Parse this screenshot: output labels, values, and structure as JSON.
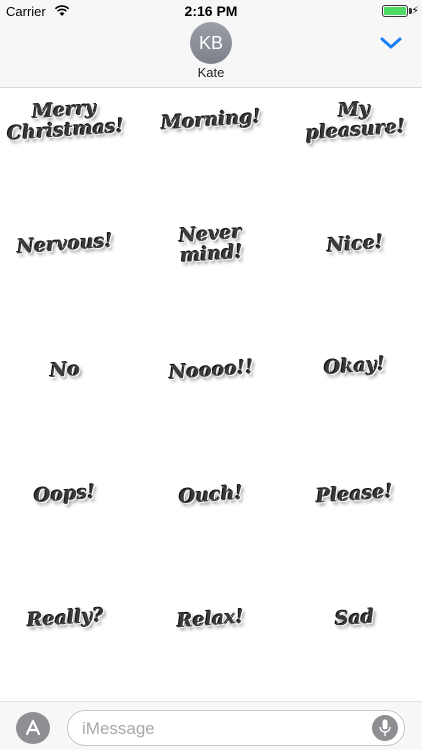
{
  "status_bar": {
    "carrier": "Carrier",
    "time": "2:16 PM",
    "battery_level": 1.0
  },
  "header": {
    "avatar_initials": "KB",
    "contact_name": "Kate"
  },
  "stickers": [
    "Merry Christmas!",
    "Morning!",
    "My pleasure!",
    "Nervous!",
    "Never mind!",
    "Nice!",
    "No",
    "Noooo!!",
    "Okay!",
    "Oops!",
    "Ouch!",
    "Please!",
    "Really?",
    "Relax!",
    "Sad"
  ],
  "input_bar": {
    "placeholder": "iMessage"
  },
  "icons": [
    "wifi-icon",
    "battery-icon",
    "chevron-down-icon",
    "app-store-icon",
    "microphone-icon"
  ]
}
